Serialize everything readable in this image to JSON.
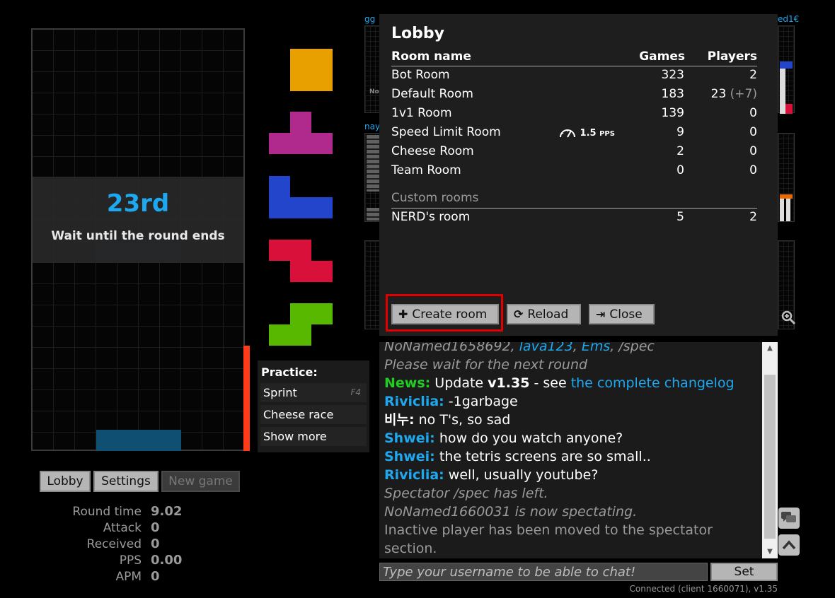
{
  "board": {
    "placement": "23rd",
    "wait_message": "Wait until the round ends"
  },
  "queue": [
    {
      "name": "O",
      "color": "#e8a000"
    },
    {
      "name": "T",
      "color": "#b02a8e"
    },
    {
      "name": "J",
      "color": "#2345cc"
    },
    {
      "name": "Z",
      "color": "#d8103a"
    },
    {
      "name": "S",
      "color": "#58b800"
    }
  ],
  "practice": {
    "title": "Practice:",
    "items": [
      {
        "label": "Sprint",
        "key": "F4"
      },
      {
        "label": "Cheese race",
        "key": ""
      },
      {
        "label": "Show more",
        "key": ""
      }
    ]
  },
  "buttons": {
    "lobby": "Lobby",
    "settings": "Settings",
    "new_game": "New game"
  },
  "stats": [
    {
      "label": "Round time",
      "value": "9.02"
    },
    {
      "label": "Attack",
      "value": "0"
    },
    {
      "label": "Received",
      "value": "0"
    },
    {
      "label": "PPS",
      "value": "0.00"
    },
    {
      "label": "APM",
      "value": "0"
    }
  ],
  "spectators": {
    "names": [
      "gg",
      "nay",
      "ed1€"
    ],
    "partial_label": "No"
  },
  "lobby": {
    "title": "Lobby",
    "columns": {
      "name": "Room name",
      "games": "Games",
      "players": "Players"
    },
    "rooms": [
      {
        "name": "Bot Room",
        "games": "323",
        "players": "2",
        "extra": ""
      },
      {
        "name": "Default Room",
        "games": "183",
        "players": "23",
        "extra": "(+7)"
      },
      {
        "name": "1v1 Room",
        "games": "139",
        "players": "0",
        "extra": ""
      },
      {
        "name": "Speed Limit Room",
        "games": "9",
        "players": "0",
        "extra": "",
        "pps_limit": "1.5",
        "pps_unit": "PPS"
      },
      {
        "name": "Cheese Room",
        "games": "2",
        "players": "0",
        "extra": ""
      },
      {
        "name": "Team Room",
        "games": "0",
        "players": "0",
        "extra": ""
      }
    ],
    "custom_label": "Custom rooms",
    "custom_rooms": [
      {
        "name": "NERD's room",
        "games": "5",
        "players": "2"
      }
    ],
    "buttons": {
      "create": "Create room",
      "reload": "Reload",
      "close": "Close"
    }
  },
  "chat": {
    "lines": {
      "l0_a": "NoNamed1658692, ",
      "l0_b": "lava123",
      "l0_c": ", ",
      "l0_d": "Ems",
      "l0_e": ", /spec",
      "l1": "Please wait for the next round",
      "l2_who": "News",
      "l2_a": " Update ",
      "l2_ver": "v1.35",
      "l2_b": " - see ",
      "l2_link": "the complete changelog",
      "l3_who": "Riviclia",
      "l3_msg": " -1garbage",
      "l4_who": "비누",
      "l4_msg": " no T's, so sad",
      "l5_who": "Shwei",
      "l5_msg": " how do you watch anyone?",
      "l6_who": "Shwei",
      "l6_msg": " the tetris screens are so small..",
      "l7_who": "Riviclia",
      "l7_msg": " well, usually youtube?",
      "l8": "Spectator /spec has left.",
      "l9": "NoNamed1660031 is now spectating.",
      "l10": "Inactive player has been moved to the spectator section."
    },
    "colon": ":",
    "input_placeholder": "Type your username to be able to chat!",
    "set_label": "Set",
    "status": "Connected (client 1660071), v1.35"
  },
  "icons": {
    "zoom": "zoom-icon",
    "chat": "chat-bubble-icon",
    "scroll_top": "chevron-up-icon"
  }
}
